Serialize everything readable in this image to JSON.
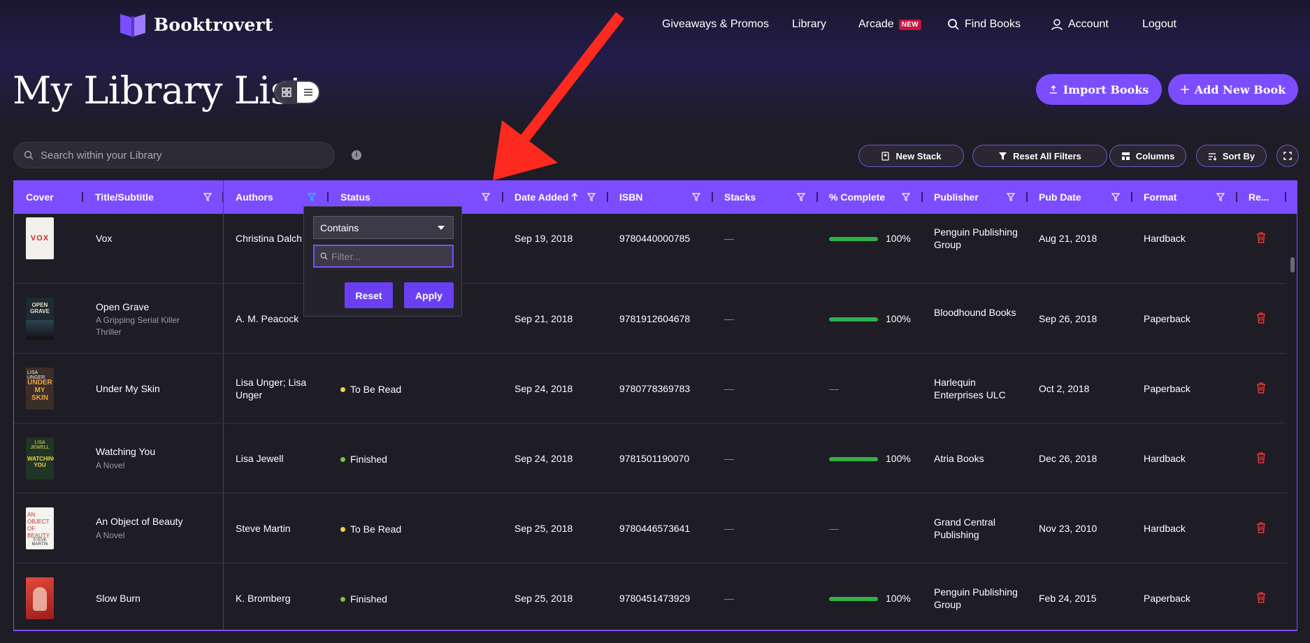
{
  "brand": {
    "name": "Booktrovert"
  },
  "nav": {
    "giveaways": "Giveaways & Promos",
    "library": "Library",
    "arcade": "Arcade",
    "arcade_badge": "NEW",
    "find_books": "Find Books",
    "account": "Account",
    "logout": "Logout"
  },
  "page": {
    "title": "My Library List",
    "import_label": "Import Books",
    "add_label": "Add New Book"
  },
  "search": {
    "placeholder": "Search within your Library"
  },
  "toolbar": {
    "new_stack": "New Stack",
    "reset_filters": "Reset All Filters",
    "columns": "Columns",
    "sort_by": "Sort By"
  },
  "columns": [
    "Cover",
    "Title/Subtitle",
    "Authors",
    "Status",
    "Date Added",
    "ISBN",
    "Stacks",
    "% Complete",
    "Publisher",
    "Pub Date",
    "Format",
    "Re..."
  ],
  "rows": [
    {
      "title": "Vox",
      "subtitle": "",
      "authors": "Christina Dalch",
      "status": "",
      "date_added": "Sep 19, 2018",
      "isbn": "9780440000785",
      "stacks": "—",
      "complete": "100%",
      "publisher": "Penguin Publishing Group",
      "pub_date": "Aug 21, 2018",
      "format": "Hardback"
    },
    {
      "title": "Open Grave",
      "subtitle": "A Gripping Serial Killer Thriller",
      "authors": "A. M. Peacock",
      "status": "",
      "date_added": "Sep 21, 2018",
      "isbn": "9781912604678",
      "stacks": "—",
      "complete": "100%",
      "publisher": "Bloodhound Books",
      "pub_date": "Sep 26, 2018",
      "format": "Paperback"
    },
    {
      "title": "Under My Skin",
      "subtitle": "",
      "authors": "Lisa Unger; Lisa Unger",
      "status": "To Be Read",
      "date_added": "Sep 24, 2018",
      "isbn": "9780778369783",
      "stacks": "—",
      "complete": "—",
      "publisher": "Harlequin Enterprises ULC",
      "pub_date": "Oct 2, 2018",
      "format": "Paperback"
    },
    {
      "title": "Watching You",
      "subtitle": "A Novel",
      "authors": "Lisa Jewell",
      "status": "Finished",
      "date_added": "Sep 24, 2018",
      "isbn": "9781501190070",
      "stacks": "—",
      "complete": "100%",
      "publisher": "Atria Books",
      "pub_date": "Dec 26, 2018",
      "format": "Hardback"
    },
    {
      "title": "An Object of Beauty",
      "subtitle": "A Novel",
      "authors": "Steve Martin",
      "status": "To Be Read",
      "date_added": "Sep 25, 2018",
      "isbn": "9780446573641",
      "stacks": "—",
      "complete": "—",
      "publisher": "Grand Central Publishing",
      "pub_date": "Nov 23, 2010",
      "format": "Hardback"
    },
    {
      "title": "Slow Burn",
      "subtitle": "",
      "authors": "K. Bromberg",
      "status": "Finished",
      "date_added": "Sep 25, 2018",
      "isbn": "9780451473929",
      "stacks": "—",
      "complete": "100%",
      "publisher": "Penguin Publishing Group",
      "pub_date": "Feb 24, 2015",
      "format": "Paperback"
    }
  ],
  "filter_popup": {
    "operator": "Contains",
    "placeholder": "Filter...",
    "reset": "Reset",
    "apply": "Apply"
  },
  "colors": {
    "accent": "#7c4dff",
    "background": "#1e1c24",
    "progress": "#2fb144",
    "to_be_read_dot": "#f2d43a",
    "finished_dot": "#7fc241",
    "delete": "#e23b3b",
    "annotation_arrow": "#ff2a1f"
  }
}
